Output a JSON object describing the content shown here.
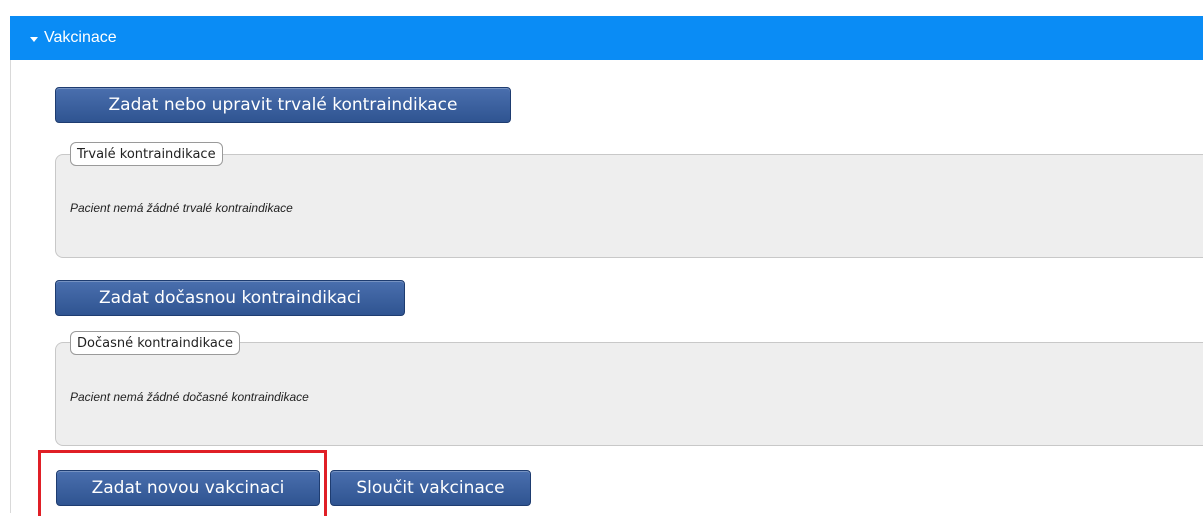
{
  "header": {
    "title": "Vakcinace",
    "caret_icon": "caret-down-icon"
  },
  "permanent": {
    "button_label": "Zadat nebo upravit trvalé kontraindikace",
    "legend": "Trvalé kontraindikace",
    "empty_text": "Pacient nemá žádné trvalé kontraindikace"
  },
  "temporary": {
    "button_label": "Zadat dočasnou kontraindikaci",
    "legend": "Dočasné kontraindikace",
    "empty_text": "Pacient nemá žádné dočasné kontraindikace"
  },
  "actions": {
    "new_vaccination_label": "Zadat novou vakcinaci",
    "merge_vaccinations_label": "Sloučit vakcinace"
  },
  "colors": {
    "header_bg": "#0a8cf5",
    "button_bg": "#2f5491",
    "highlight": "#e01f26"
  }
}
